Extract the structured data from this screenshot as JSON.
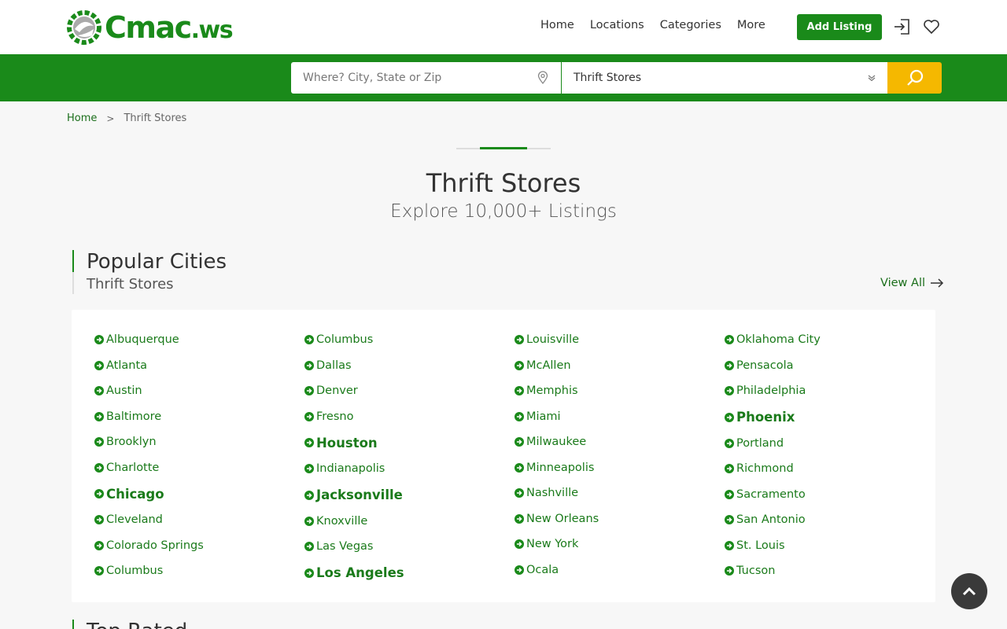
{
  "brand": {
    "name": "Cmac",
    "ext": ".ws"
  },
  "nav": {
    "home": "Home",
    "locations": "Locations",
    "categories": "Categories",
    "more": "More"
  },
  "header": {
    "add_listing": "Add Listing"
  },
  "search": {
    "where_placeholder": "Where? City, State or Zip",
    "category_value": "Thrift Stores"
  },
  "breadcrumb": {
    "home": "Home",
    "separator": ">",
    "current": "Thrift Stores"
  },
  "hero": {
    "title": "Thrift Stores",
    "subtitle": "Explore 10,000+ Listings"
  },
  "section": {
    "title": "Popular Cities",
    "subtitle": "Thrift Stores",
    "view_all": "View All"
  },
  "next_section": {
    "title": "Top Rated"
  },
  "cities": [
    [
      {
        "name": "Albuquerque",
        "big": false
      },
      {
        "name": "Atlanta",
        "big": false
      },
      {
        "name": "Austin",
        "big": false
      },
      {
        "name": "Baltimore",
        "big": false
      },
      {
        "name": "Brooklyn",
        "big": false
      },
      {
        "name": "Charlotte",
        "big": false
      },
      {
        "name": "Chicago",
        "big": true
      },
      {
        "name": "Cleveland",
        "big": false
      },
      {
        "name": "Colorado Springs",
        "big": false
      },
      {
        "name": "Columbus",
        "big": false
      }
    ],
    [
      {
        "name": "Columbus",
        "big": false
      },
      {
        "name": "Dallas",
        "big": false
      },
      {
        "name": "Denver",
        "big": false
      },
      {
        "name": "Fresno",
        "big": false
      },
      {
        "name": "Houston",
        "big": true
      },
      {
        "name": "Indianapolis",
        "big": false
      },
      {
        "name": "Jacksonville",
        "big": true
      },
      {
        "name": "Knoxville",
        "big": false
      },
      {
        "name": "Las Vegas",
        "big": false
      },
      {
        "name": "Los Angeles",
        "big": true
      }
    ],
    [
      {
        "name": "Louisville",
        "big": false
      },
      {
        "name": "McAllen",
        "big": false
      },
      {
        "name": "Memphis",
        "big": false
      },
      {
        "name": "Miami",
        "big": false
      },
      {
        "name": "Milwaukee",
        "big": false
      },
      {
        "name": "Minneapolis",
        "big": false
      },
      {
        "name": "Nashville",
        "big": false
      },
      {
        "name": "New Orleans",
        "big": false
      },
      {
        "name": "New York",
        "big": false
      },
      {
        "name": "Ocala",
        "big": false
      }
    ],
    [
      {
        "name": "Oklahoma City",
        "big": false
      },
      {
        "name": "Pensacola",
        "big": false
      },
      {
        "name": "Philadelphia",
        "big": false
      },
      {
        "name": "Phoenix",
        "big": true
      },
      {
        "name": "Portland",
        "big": false
      },
      {
        "name": "Richmond",
        "big": false
      },
      {
        "name": "Sacramento",
        "big": false
      },
      {
        "name": "San Antonio",
        "big": false
      },
      {
        "name": "St. Louis",
        "big": false
      },
      {
        "name": "Tucson",
        "big": false
      }
    ]
  ],
  "colors": {
    "brand_green": "#1a8a1a",
    "search_yellow": "#f5b800"
  },
  "icons": {
    "login": "login-icon",
    "favorites": "heart-icon",
    "pin": "map-pin-icon",
    "chevron": "chevron-down-icon",
    "search": "search-icon",
    "arrow": "arrow-right-icon",
    "to_top": "chevron-up-icon",
    "city_bullet": "arrow-circle-right-icon"
  }
}
